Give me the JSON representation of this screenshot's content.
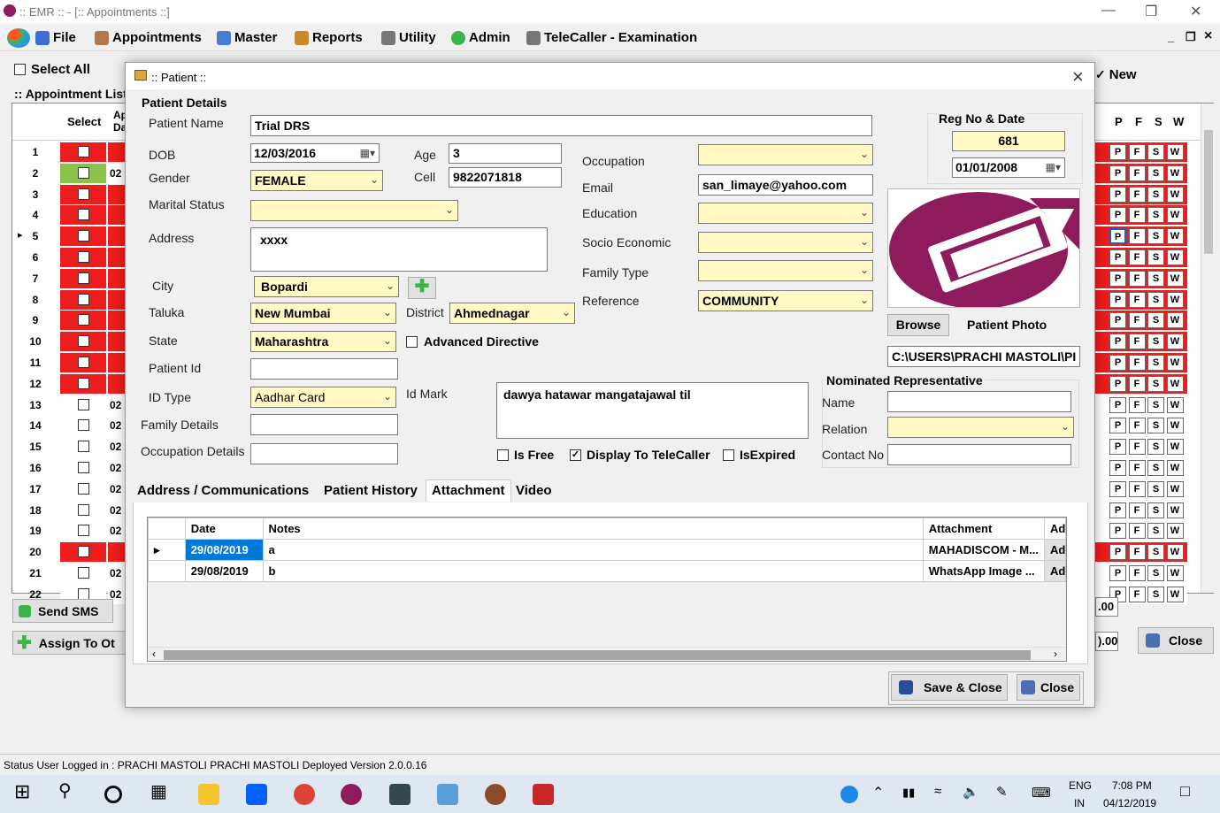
{
  "window": {
    "title": ":: EMR :: - [:: Appointments ::]"
  },
  "menu": [
    "File",
    "Appointments",
    "Master",
    "Reports",
    "Utility",
    "Admin",
    "TeleCaller - Examination"
  ],
  "mdi_controls": [
    "_",
    "ř",
    "×"
  ],
  "background": {
    "select_all": "Select All",
    "new_label": "New",
    "appointment_list": ":: Appointment List",
    "col_select": "Select",
    "col_ap": "Ap Da",
    "pfsw_headers": [
      "P",
      "F",
      "S",
      "W"
    ],
    "row_code": "02",
    "rows": [
      {
        "n": "1",
        "state": "red"
      },
      {
        "n": "2",
        "state": "green"
      },
      {
        "n": "3",
        "state": "red"
      },
      {
        "n": "4",
        "state": "red"
      },
      {
        "n": "5",
        "state": "red"
      },
      {
        "n": "6",
        "state": "red"
      },
      {
        "n": "7",
        "state": "red"
      },
      {
        "n": "8",
        "state": "red"
      },
      {
        "n": "9",
        "state": "red"
      },
      {
        "n": "10",
        "state": "red"
      },
      {
        "n": "11",
        "state": "red"
      },
      {
        "n": "12",
        "state": "red"
      },
      {
        "n": "13",
        "state": "white"
      },
      {
        "n": "14",
        "state": "white"
      },
      {
        "n": "15",
        "state": "white"
      },
      {
        "n": "16",
        "state": "white"
      },
      {
        "n": "17",
        "state": "white"
      },
      {
        "n": "18",
        "state": "white"
      },
      {
        "n": "19",
        "state": "white"
      },
      {
        "n": "20",
        "state": "red"
      },
      {
        "n": "21",
        "state": "white"
      },
      {
        "n": "22",
        "state": "white"
      }
    ],
    "send_sms": "Send SMS",
    "assign_to": "Assign To Ot",
    "amount1": ".00",
    "amount2": ").00",
    "close": "Close"
  },
  "dialog": {
    "title": ":: Patient ::",
    "section": "Patient Details",
    "labels": {
      "patient_name": "Patient Name",
      "dob": "DOB",
      "age": "Age",
      "gender": "Gender",
      "cell": "Cell",
      "marital": "Marital Status",
      "address": "Address",
      "city": "City",
      "taluka": "Taluka",
      "district": "District",
      "state": "State",
      "patient_id": "Patient Id",
      "id_type": "ID Type",
      "id_mark": "Id Mark",
      "family_details": "Family Details",
      "occupation_details": "Occupation Details",
      "occupation": "Occupation",
      "email": "Email",
      "education": "Education",
      "socio": "Socio Economic",
      "family_type": "Family Type",
      "reference": "Reference",
      "reg_no": "Reg No & Date",
      "browse": "Browse",
      "patient_photo": "Patient Photo",
      "nominated": "Nominated Representative",
      "name": "Name",
      "relation": "Relation",
      "contact": "Contact No",
      "advanced_directive": "Advanced Directive",
      "is_free": "Is Free",
      "display_telecaller": "Display To TeleCaller",
      "is_expired": "IsExpired"
    },
    "values": {
      "patient_name": "Trial DRS",
      "dob": "12/03/2016",
      "age": "3",
      "gender": "FEMALE",
      "cell": "9822071818",
      "marital": "",
      "address": "xxxx",
      "city": "Bopardi",
      "taluka": "New Mumbai",
      "district": "Ahmednagar",
      "state": "Maharashtra",
      "patient_id": "",
      "id_type": "Aadhar Card",
      "id_mark": "dawya hatawar mangatajawal til",
      "family_details": "",
      "occupation_details": "",
      "occupation": "",
      "email": "san_limaye@yahoo.com",
      "education": "",
      "socio": "",
      "family_type": "",
      "reference": "COMMUNITY",
      "reg_no": "681",
      "reg_date": "01/01/2008",
      "photo_path": "C:\\USERS\\PRACHI MASTOLI\\PI",
      "nom_name": "",
      "nom_relation": "",
      "nom_contact": ""
    },
    "checks": {
      "advanced_directive": false,
      "is_free": false,
      "display_telecaller": true,
      "is_expired": false
    },
    "tabs": [
      "Address / Communications",
      "Patient History",
      "Attachment",
      "Video"
    ],
    "active_tab": "Attachment",
    "attachments": {
      "headers": [
        "Date",
        "Notes",
        "Attachment",
        "Ad"
      ],
      "rows": [
        {
          "date": "29/08/2019",
          "notes": "a",
          "attachment": "MAHADISCOM - M...",
          "ad": "Ad"
        },
        {
          "date": "29/08/2019",
          "notes": "b",
          "attachment": "WhatsApp Image ...",
          "ad": "Ad"
        }
      ]
    },
    "save_close": "Save & Close",
    "close": "Close",
    "close_x": "×"
  },
  "status_bar": {
    "text": "Status  User Logged in : PRACHI MASTOLI  PRACHI MASTOLI  Deployed Version 2.0.0.16"
  },
  "taskbar": {
    "lang1": "ENG",
    "lang2": "IN",
    "time": "7:08 PM",
    "date": "04/12/2019"
  },
  "colors": {
    "red": "#ee1c1c",
    "green": "#8bc34a",
    "yellow_field": "#fff9c4",
    "logo": "#8e1b5b"
  }
}
